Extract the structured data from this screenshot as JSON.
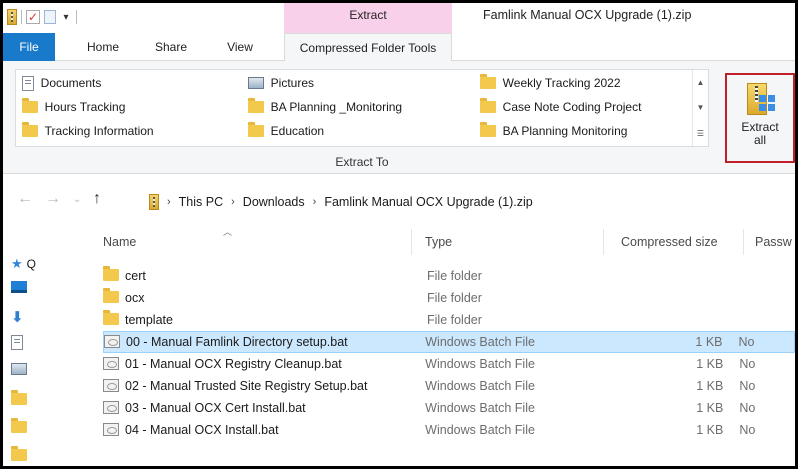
{
  "window": {
    "context_tab": "Extract",
    "title": "Famlink Manual OCX Upgrade (1).zip"
  },
  "tabs": {
    "file": "File",
    "home": "Home",
    "share": "Share",
    "view": "View",
    "compressed": "Compressed Folder Tools"
  },
  "ribbon": {
    "destinations": [
      {
        "label": "Documents",
        "icon": "document-icon"
      },
      {
        "label": "Hours Tracking",
        "icon": "folder-icon"
      },
      {
        "label": "Tracking Information",
        "icon": "folder-icon"
      },
      {
        "label": "Pictures",
        "icon": "pictures-icon"
      },
      {
        "label": "BA Planning _Monitoring",
        "icon": "folder-icon"
      },
      {
        "label": "Education",
        "icon": "folder-icon"
      },
      {
        "label": "Weekly Tracking 2022",
        "icon": "folder-icon"
      },
      {
        "label": "Case Note Coding Project",
        "icon": "folder-icon"
      },
      {
        "label": "BA Planning Monitoring",
        "icon": "folder-icon"
      }
    ],
    "group_label": "Extract To",
    "extract_all_line1": "Extract",
    "extract_all_line2": "all"
  },
  "address": {
    "crumbs": [
      "This PC",
      "Downloads",
      "Famlink Manual OCX Upgrade (1).zip"
    ]
  },
  "columns": {
    "name": "Name",
    "type": "Type",
    "compressed_size": "Compressed size",
    "password": "Passw"
  },
  "nav_pane": {
    "quick_access_initial": "Q"
  },
  "files": [
    {
      "name": "cert",
      "type": "File folder",
      "size": "",
      "pw": "",
      "kind": "folder"
    },
    {
      "name": "ocx",
      "type": "File folder",
      "size": "",
      "pw": "",
      "kind": "folder"
    },
    {
      "name": "template",
      "type": "File folder",
      "size": "",
      "pw": "",
      "kind": "folder"
    },
    {
      "name": "00 - Manual Famlink Directory setup.bat",
      "type": "Windows Batch File",
      "size": "1 KB",
      "pw": "No",
      "kind": "bat",
      "selected": true
    },
    {
      "name": "01 - Manual OCX Registry Cleanup.bat",
      "type": "Windows Batch File",
      "size": "1 KB",
      "pw": "No",
      "kind": "bat"
    },
    {
      "name": "02 - Manual Trusted Site Registry Setup.bat",
      "type": "Windows Batch File",
      "size": "1 KB",
      "pw": "No",
      "kind": "bat"
    },
    {
      "name": "03 - Manual OCX Cert Install.bat",
      "type": "Windows Batch File",
      "size": "1 KB",
      "pw": "No",
      "kind": "bat"
    },
    {
      "name": "04 - Manual OCX Install.bat",
      "type": "Windows Batch File",
      "size": "1 KB",
      "pw": "No",
      "kind": "bat"
    }
  ],
  "colors": {
    "file_tab": "#1979ca",
    "context_tab": "#f9d0ea",
    "selection": "#cce8ff",
    "highlight_border": "#c0202a"
  }
}
